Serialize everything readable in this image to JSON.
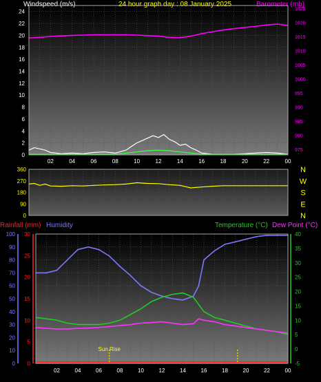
{
  "colors": {
    "background": "#000000",
    "wind": "#ffffff",
    "gust": "#44ff44",
    "barometer": "#ff00ff",
    "direction": "#ffff00",
    "humidity": "#7b7bff",
    "temperature": "#22cc22",
    "dewpoint": "#ff33ff",
    "rainfall": "#ff2222",
    "marker": "#ffff00"
  },
  "chart_data": [
    {
      "type": "line",
      "name": "wind-barometer",
      "title": "24 hour graph day : 08 January 2025",
      "left_label": "Windspeed (m/s)",
      "right_label": "Barometer (mb)",
      "x_ticks": [
        "02",
        "04",
        "06",
        "08",
        "10",
        "12",
        "14",
        "16",
        "18",
        "20",
        "22",
        "00"
      ],
      "y_left_ticks": [
        "0",
        "2",
        "4",
        "6",
        "8",
        "10",
        "12",
        "14",
        "16",
        "18",
        "20",
        "22",
        "24"
      ],
      "y_left_range": [
        0,
        25
      ],
      "y_right_ticks": [
        "975",
        "980",
        "985",
        "990",
        "995",
        "1000",
        "1005",
        "1010",
        "1015",
        "1020",
        "1025"
      ],
      "y_right_range": [
        973,
        1026
      ],
      "grid": true,
      "series": [
        {
          "key": "barometer",
          "x": [
            0,
            1,
            2,
            3,
            4,
            5,
            6,
            7,
            8,
            9,
            10,
            11,
            12,
            13,
            14,
            15,
            16,
            17,
            18,
            19,
            20,
            21,
            22,
            23,
            24
          ],
          "values": [
            1014.5,
            1014.7,
            1015.0,
            1015.2,
            1015.4,
            1015.5,
            1015.6,
            1015.6,
            1015.6,
            1015.6,
            1015.5,
            1015.3,
            1015.1,
            1014.7,
            1014.6,
            1015.1,
            1016.0,
            1016.7,
            1017.3,
            1017.8,
            1018.2,
            1018.6,
            1019.1,
            1019.4,
            1018.9
          ]
        },
        {
          "key": "wind",
          "x": [
            0,
            0.5,
            1,
            1.5,
            2,
            3,
            4,
            5,
            6,
            7,
            8,
            9,
            9.5,
            10,
            10.5,
            11,
            11.5,
            12,
            12.5,
            13,
            13.5,
            14,
            14.5,
            15,
            15.5,
            16,
            17,
            18,
            19,
            20,
            21,
            22,
            23,
            24
          ],
          "values": [
            0.8,
            1.2,
            1.0,
            0.8,
            0.4,
            0.2,
            0.3,
            0.2,
            0.4,
            0.5,
            0.3,
            0.8,
            1.4,
            2.0,
            2.4,
            2.8,
            3.2,
            2.9,
            3.4,
            2.6,
            2.2,
            1.6,
            1.8,
            1.2,
            0.8,
            0.3,
            0.1,
            0.1,
            0.1,
            0.2,
            0.3,
            0.4,
            0.3,
            0.1
          ]
        },
        {
          "key": "gust",
          "x": [
            0,
            2,
            4,
            6,
            8,
            9,
            10,
            11,
            12,
            13,
            14,
            15,
            16,
            18,
            20,
            22,
            24
          ],
          "values": [
            0.1,
            0.1,
            0.1,
            0.1,
            0.1,
            0.3,
            0.5,
            0.7,
            0.8,
            0.7,
            0.5,
            0.3,
            0.1,
            0.1,
            0.1,
            0.1,
            0.1
          ]
        }
      ]
    },
    {
      "type": "line",
      "name": "wind-direction",
      "x_ticks": [],
      "y_ticks": [
        "360",
        "270",
        "180",
        "90",
        "0"
      ],
      "y_range": [
        0,
        360
      ],
      "compass_labels": [
        "N",
        "W",
        "S",
        "E",
        "N"
      ],
      "series": [
        {
          "key": "direction",
          "x": [
            0,
            0.5,
            1,
            1.5,
            2,
            3,
            4,
            5,
            6,
            7,
            8,
            9,
            10,
            11,
            12,
            13,
            14,
            15,
            16,
            17,
            18,
            19,
            20,
            21,
            22,
            23,
            24
          ],
          "values": [
            245,
            250,
            235,
            245,
            230,
            228,
            232,
            230,
            235,
            238,
            240,
            245,
            255,
            250,
            248,
            240,
            235,
            215,
            222,
            228,
            232,
            232,
            232,
            232,
            232,
            232,
            232
          ]
        }
      ]
    },
    {
      "type": "line",
      "name": "rain-humidity-temperature",
      "left_labels": [
        "Rainfall (mm)",
        "Humidity"
      ],
      "right_labels": [
        "Temperature (°C)",
        "Dew Point (°C)"
      ],
      "x_ticks": [
        "02",
        "04",
        "06",
        "08",
        "10",
        "12",
        "14",
        "16",
        "18",
        "20",
        "22",
        "00"
      ],
      "humidity_ticks": [
        "0",
        "10",
        "20",
        "30",
        "40",
        "50",
        "60",
        "70",
        "80",
        "90",
        "100"
      ],
      "humidity_range": [
        0,
        100
      ],
      "rain_ticks": [
        "0",
        "5",
        "10",
        "15",
        "20",
        "25",
        "30"
      ],
      "rain_range": [
        0,
        30
      ],
      "temp_ticks": [
        "-5",
        "0",
        "5",
        "10",
        "15",
        "20",
        "25",
        "30",
        "35",
        "40"
      ],
      "temp_range": [
        -5,
        40
      ],
      "annotation": "Sun Rise",
      "markers_hour": [
        7.0,
        19.2
      ],
      "grid": true,
      "series": [
        {
          "key": "humidity",
          "x": [
            0,
            1,
            2,
            3,
            4,
            5,
            6,
            7,
            8,
            9,
            10,
            11,
            12,
            13,
            14,
            15,
            15.5,
            16,
            17,
            18,
            19,
            20,
            21,
            22,
            23,
            24
          ],
          "values": [
            70,
            70,
            72,
            80,
            88,
            90,
            88,
            83,
            75,
            68,
            60,
            55,
            52,
            50,
            49,
            52,
            60,
            80,
            87,
            92,
            94,
            96,
            98,
            99,
            99,
            99
          ]
        },
        {
          "key": "temperature",
          "x": [
            0,
            1,
            2,
            3,
            4,
            5,
            6,
            7,
            8,
            9,
            10,
            11,
            12,
            13,
            14,
            15,
            16,
            17,
            18,
            19,
            20,
            21,
            22,
            23,
            24
          ],
          "values": [
            11,
            10.5,
            10,
            9,
            8.5,
            8.5,
            8.5,
            9,
            10,
            12,
            14,
            16.5,
            18,
            19,
            19.5,
            18,
            13,
            11,
            10,
            9,
            8,
            7,
            6.5,
            6,
            5
          ]
        },
        {
          "key": "dewpoint",
          "x": [
            0,
            1,
            2,
            3,
            4,
            5,
            6,
            7,
            8,
            9,
            10,
            11,
            12,
            13,
            14,
            15,
            15.5,
            16,
            17,
            18,
            19,
            20,
            21,
            22,
            23,
            24
          ],
          "values": [
            7.5,
            7.2,
            7.0,
            7.0,
            7.2,
            7.3,
            7.5,
            7.8,
            8.2,
            8.5,
            9,
            9.2,
            9.5,
            9.0,
            8.5,
            8.8,
            10.5,
            10,
            9.5,
            8.5,
            8,
            7.5,
            7,
            6.5,
            6,
            5.5
          ]
        },
        {
          "key": "rainfall",
          "x": [
            0,
            24
          ],
          "values": [
            0.3,
            0.3
          ]
        }
      ]
    }
  ]
}
